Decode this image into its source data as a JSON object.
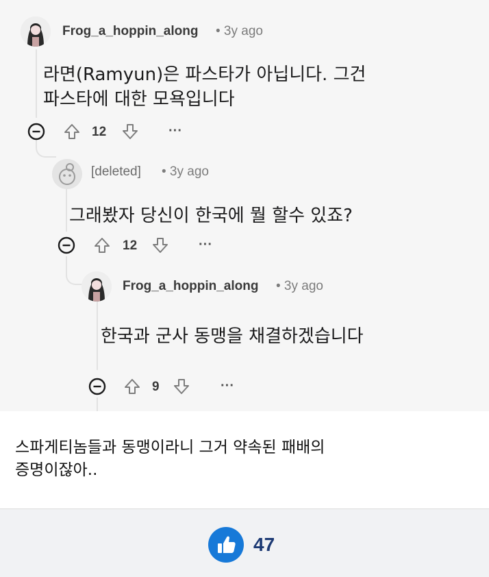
{
  "comments": [
    {
      "author": "Frog_a_hoppin_along",
      "time": "• 3y ago",
      "lines": [
        "라면(Ramyun)은 파스타가 아닙니다. 그건",
        "파스타에 대한 모욕입니다"
      ],
      "votes": "12",
      "more": "···"
    },
    {
      "author": "[deleted]",
      "time": "• 3y ago",
      "lines": [
        "그래봤자 당신이 한국에 뭘 할수 있죠?"
      ],
      "votes": "12",
      "more": "···"
    },
    {
      "author": "Frog_a_hoppin_along",
      "time": "• 3y ago",
      "lines": [
        "한국과 군사 동맹을 채결하겠습니다"
      ],
      "votes": "9",
      "more": "···"
    }
  ],
  "caption": {
    "lines": [
      "스파게티놈들과 동맹이라니 그거 약속된 패배의",
      "증명이잖아.."
    ]
  },
  "like": {
    "count": "47",
    "icon": "thumbs-up-icon",
    "color": "#1779d8"
  },
  "icons": {
    "collapse": "collapse-minus-icon",
    "upvote": "upvote-arrow-icon",
    "downvote": "downvote-arrow-icon"
  }
}
